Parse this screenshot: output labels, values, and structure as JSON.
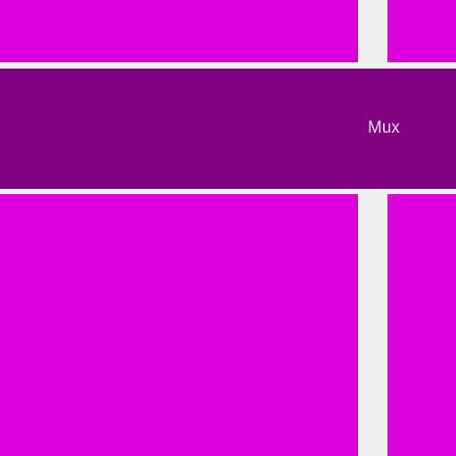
{
  "banner": {
    "label": "Mux"
  },
  "colors": {
    "background": "#efefef",
    "tile": "#dc00dc",
    "banner": "#800080",
    "banner_text": "#f6d9f6"
  }
}
